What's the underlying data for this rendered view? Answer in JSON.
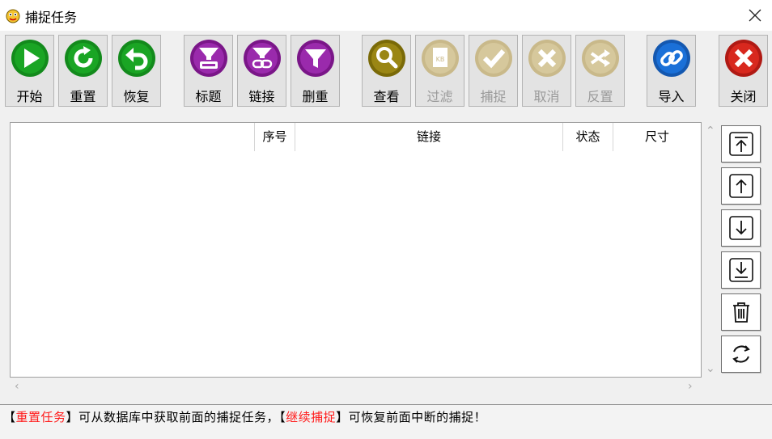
{
  "window": {
    "title": "捕捉任务"
  },
  "toolbar": {
    "start": "开始",
    "reset": "重置",
    "restore": "恢复",
    "title": "标题",
    "link": "链接",
    "dedupe": "删重",
    "view": "查看",
    "filter": "过滤",
    "capture": "捕捉",
    "cancel": "取消",
    "invert": "反置",
    "import": "导入",
    "close": "关闭"
  },
  "table": {
    "columns": [
      "序号",
      "链接",
      "状态",
      "尺寸"
    ],
    "rows": []
  },
  "hint": {
    "bracket_open": "【",
    "bracket_close": "】",
    "reset_task": "重置任务",
    "text1": "可从数据库中获取前面的捕捉任务，",
    "continue_capture": "继续捕捉",
    "text2": "可恢复前面中断的捕捉！"
  },
  "colors": {
    "green": "#138a1c",
    "purple": "#8a1f9a",
    "olive": "#8c7a10",
    "blue": "#1a66c8",
    "red": "#c8201a",
    "hint_red": "#ff1c1c"
  }
}
